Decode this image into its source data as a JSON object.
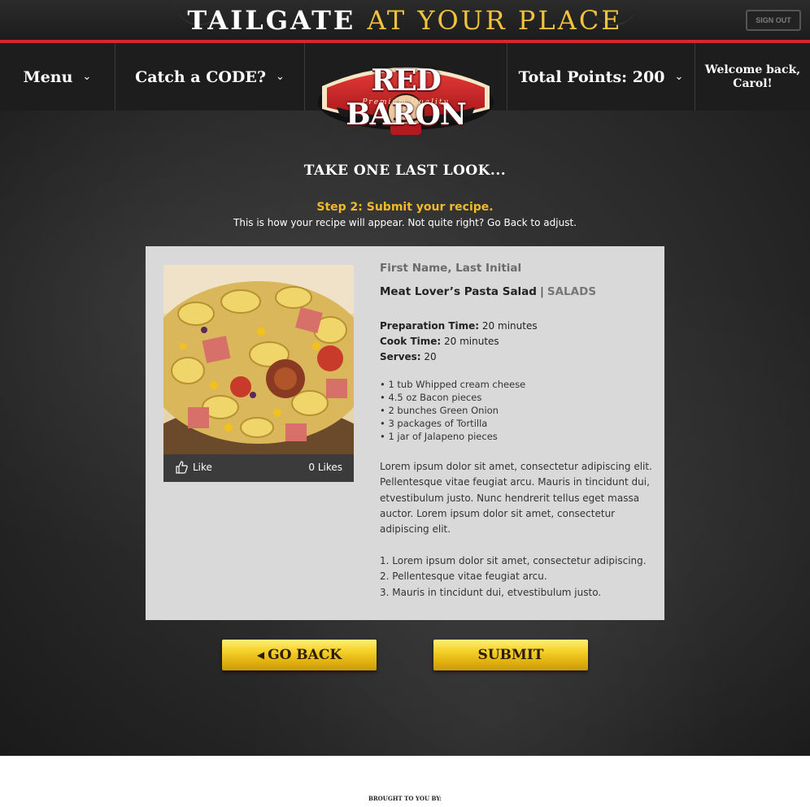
{
  "banner": {
    "title_white": "TAILGATE",
    "title_yellow": "AT YOUR PLACE",
    "sign_out": "SIGN OUT"
  },
  "nav": {
    "menu": "Menu",
    "catch_code": "Catch a CODE?",
    "total_points": "Total Points: 200",
    "welcome_line1": "Welcome back,",
    "welcome_line2": "Carol!"
  },
  "logo": {
    "brand": "RED BARON",
    "tagline": "Premium  Quality"
  },
  "page": {
    "heading": "TAKE ONE LAST LOOK...",
    "step_title": "Step 2:  Submit your recipe.",
    "step_desc": "This is how your recipe will appear. Not quite right? Go Back to adjust."
  },
  "recipe": {
    "author": "First Name, Last Initial",
    "title": "Meat Lover’s Pasta Salad",
    "separator": "|",
    "category": "SALADS",
    "prep_label": "Preparation Time:",
    "prep_value": " 20 minutes",
    "cook_label": "Cook Time:",
    "cook_value": " 20 minutes",
    "serves_label": "Serves:",
    "serves_value": " 20",
    "ingredients": [
      "• 1 tub Whipped cream cheese",
      "• 4.5 oz Bacon pieces",
      "• 2 bunches Green Onion",
      "• 3 packages of Tortilla",
      "• 1 jar of Jalapeno pieces"
    ],
    "description": "Lorem ipsum dolor sit amet, consectetur adipiscing elit. Pellentesque vitae feugiat arcu. Mauris in tincidunt dui, etvestibulum justo. Nunc hendrerit tellus eget massa auctor. Lorem ipsum dolor sit amet, consectetur adipiscing elit.",
    "steps": [
      "1. Lorem ipsum dolor sit amet, consectetur adipiscing.",
      "2. Pellentesque vitae feugiat arcu.",
      "3. Mauris in tincidunt dui, etvestibulum justo."
    ],
    "like_label": "Like",
    "likes_count": "0 Likes"
  },
  "actions": {
    "go_back": "GO BACK",
    "submit": "SUBMIT"
  },
  "footer": {
    "brought": "BROUGHT TO YOU BY:"
  },
  "icons": {
    "chevron": "chevron-down-icon",
    "like": "thumbs-up-icon",
    "back": "caret-left-icon"
  },
  "colors": {
    "accent_red": "#d9262c",
    "accent_gold": "#f2c33b",
    "step_gold": "#f2b92b",
    "card_bg": "#d9d9d9"
  }
}
